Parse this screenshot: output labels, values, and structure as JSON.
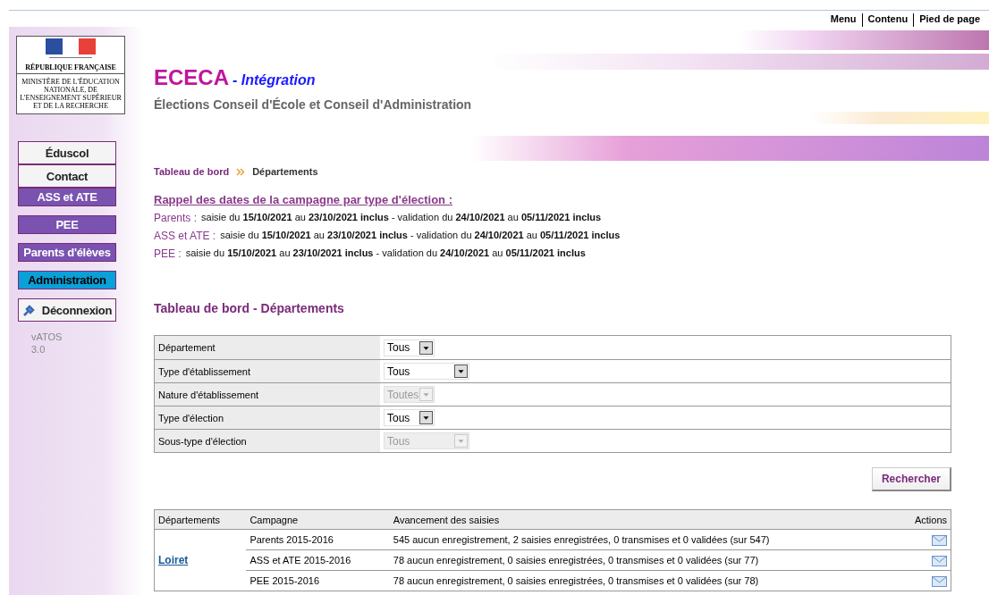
{
  "top_links": [
    "Menu",
    "Contenu",
    "Pied de page"
  ],
  "logo": {
    "republic": "RÉPUBLIQUE FRANÇAISE",
    "ministry": "MINISTÈRE DE L'ÉDUCATION NATIONALE, DE L'ENSEIGNEMENT SUPÉRIEUR ET DE LA RECHERCHE"
  },
  "app": {
    "name": "ECECA",
    "env": "- Intégration",
    "subtitle": "Élections Conseil d'École et Conseil d'Administration"
  },
  "sidebar": {
    "items": [
      {
        "label": "Éduscol",
        "kind": "link",
        "selected": false
      },
      {
        "label": "Contact",
        "kind": "link",
        "selected": false
      },
      {
        "label": "ASS et ATE",
        "kind": "election",
        "selected": false
      },
      {
        "label": "PEE",
        "kind": "election",
        "selected": false
      },
      {
        "label": "Parents d'élèves",
        "kind": "election",
        "selected": false
      },
      {
        "label": "Administration",
        "kind": "election",
        "selected": true
      },
      {
        "label": "Déconnexion",
        "kind": "logout",
        "selected": false
      }
    ],
    "version": [
      "vATOS",
      "3.0"
    ]
  },
  "breadcrumb": [
    {
      "label": "Tableau de bord",
      "kind": "link"
    },
    {
      "label": "Départements",
      "kind": "current"
    }
  ],
  "reminder": {
    "title": "Rappel des dates de la campagne par type d'élection :",
    "lines": [
      {
        "label": "Parents :",
        "text": "saisie du **15/10/2021** au **23/10/2021 inclus** - validation du **24/10/2021** au **05/11/2021 inclus**"
      },
      {
        "label": "ASS et ATE :",
        "text": "saisie du **15/10/2021** au **23/10/2021 inclus** - validation du **24/10/2021** au **05/11/2021 inclus**"
      },
      {
        "label": "PEE :",
        "text": "saisie du **15/10/2021** au **23/10/2021 inclus** - validation du **24/10/2021** au **05/11/2021 inclus**"
      }
    ]
  },
  "section_title": "Tableau de bord - Départements",
  "filters": [
    {
      "label": "Département",
      "value": "Tous",
      "disabled": false,
      "wide": false
    },
    {
      "label": "Type d'établissement",
      "value": "Tous",
      "disabled": false,
      "wide": true
    },
    {
      "label": "Nature d'établissement",
      "value": "Toutes",
      "disabled": true,
      "wide": false
    },
    {
      "label": "Type d'élection",
      "value": "Tous",
      "disabled": false,
      "wide": false
    },
    {
      "label": "Sous-type d'élection",
      "value": "Tous",
      "disabled": true,
      "wide": true
    }
  ],
  "search_button": "Rechercher",
  "results": {
    "columns": [
      "Départements",
      "Campagne",
      "Avancement des saisies",
      "Actions"
    ],
    "groups": [
      {
        "department": "Loiret",
        "rows": [
          {
            "campaign": "Parents 2015-2016",
            "progress": "545 aucun enregistrement, 2 saisies enregistrées, 0 transmises et 0 validées (sur 547)"
          },
          {
            "campaign": "ASS et ATE 2015-2016",
            "progress": "78 aucun enregistrement, 0 saisies enregistrées, 0 transmises et 0 validées (sur 77)"
          },
          {
            "campaign": "PEE 2015-2016",
            "progress": "78 aucun enregistrement, 0 saisies enregistrées, 0 transmises et 0 validées (sur 78)"
          }
        ]
      }
    ]
  }
}
